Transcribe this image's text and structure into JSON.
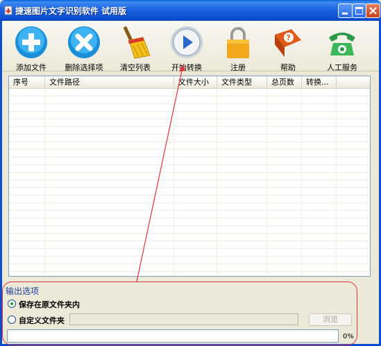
{
  "window": {
    "title": "捷速图片文字识别软件 试用版",
    "controls": [
      "minimize",
      "maximize",
      "close"
    ]
  },
  "toolbar": {
    "items": [
      {
        "label": "添加文件",
        "icon": "add-icon"
      },
      {
        "label": "删除选择项",
        "icon": "delete-icon"
      },
      {
        "label": "清空列表",
        "icon": "broom-icon"
      },
      {
        "label": "开始转换",
        "icon": "play-icon"
      },
      {
        "label": "注册",
        "icon": "lock-icon"
      },
      {
        "label": "帮助",
        "icon": "help-book-icon"
      },
      {
        "label": "人工服务",
        "icon": "phone-icon"
      }
    ]
  },
  "table": {
    "columns": [
      "序号",
      "文件路径",
      "文件大小",
      "文件类型",
      "总页数",
      "转换..."
    ],
    "rows": []
  },
  "output": {
    "title": "输出选项",
    "option_keep": "保存在原文件夹内",
    "option_custom": "自定义文件夹",
    "selected": "保存在原文件夹内",
    "path_value": "",
    "browse_label": "浏览",
    "progress_percent": 0,
    "progress_text": "0%"
  },
  "colors": {
    "titlebar": "#0a4fd0",
    "annotation": "#e0303a",
    "table_border": "#7f9db9"
  }
}
